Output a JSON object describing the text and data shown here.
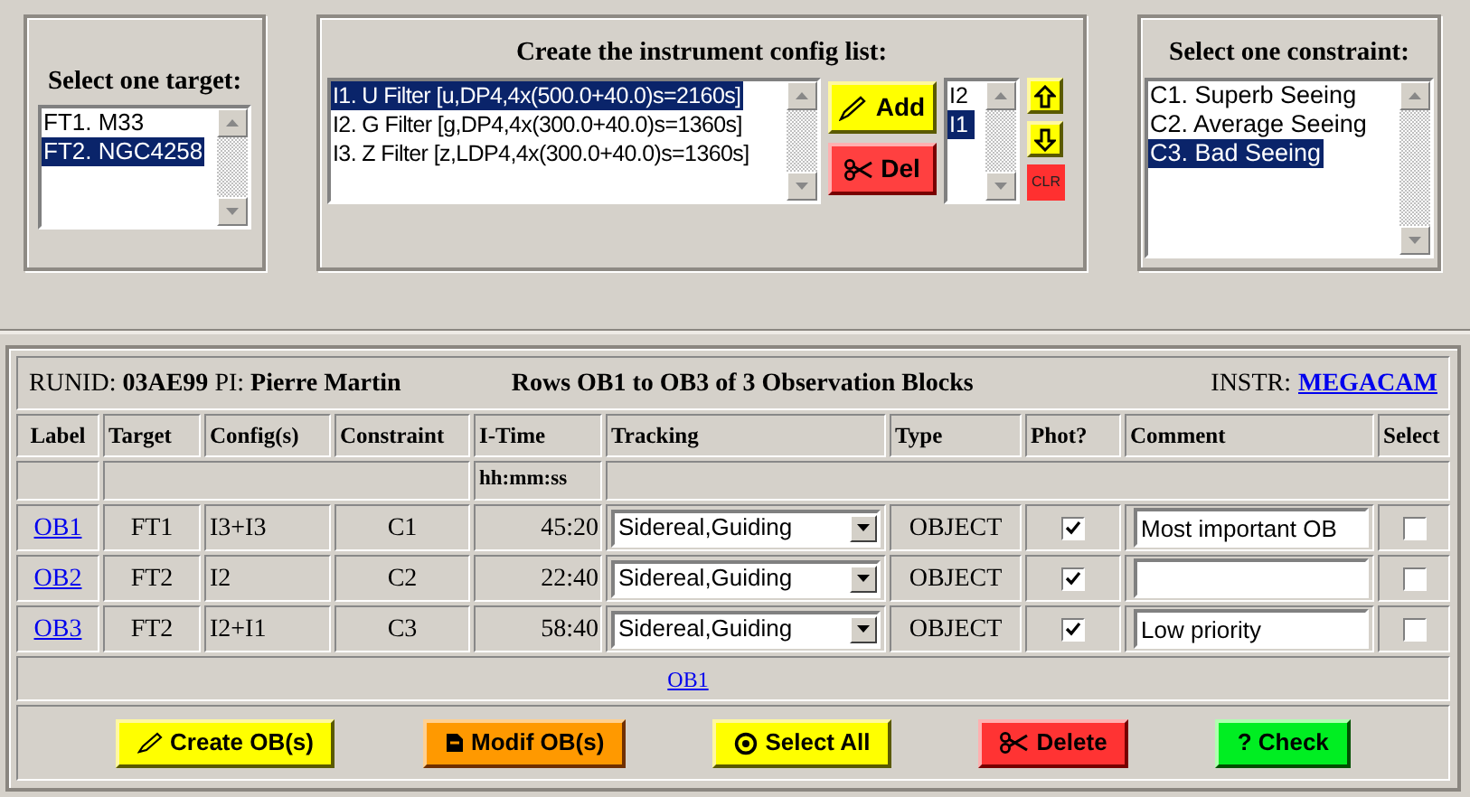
{
  "targets": {
    "title": "Select one target:",
    "items": [
      {
        "label": "FT1. M33",
        "selected": false
      },
      {
        "label": "FT2. NGC4258",
        "selected": true
      }
    ]
  },
  "configs": {
    "title": "Create the instrument config list:",
    "items": [
      {
        "label": "I1. U Filter [u,DP4,4x(500.0+40.0)s=2160s]",
        "selected": true
      },
      {
        "label": "I2. G Filter [g,DP4,4x(300.0+40.0)s=1360s]",
        "selected": false
      },
      {
        "label": "I3. Z Filter [z,LDP4,4x(300.0+40.0)s=1360s]",
        "selected": false
      }
    ],
    "add_button": "Add",
    "del_button": "Del",
    "chosen": [
      {
        "label": "I2",
        "selected": false
      },
      {
        "label": "I1",
        "selected": true
      }
    ],
    "clear_button": "CLR"
  },
  "constraints": {
    "title": "Select one constraint:",
    "items": [
      {
        "label": "C1. Superb Seeing",
        "selected": false
      },
      {
        "label": "C2. Average Seeing",
        "selected": false
      },
      {
        "label": "C3. Bad Seeing",
        "selected": true
      }
    ]
  },
  "header": {
    "runid_label": "RUNID:",
    "runid": "03AE99",
    "pi_label": "PI:",
    "pi": "Pierre Martin",
    "rows_text": "Rows OB1 to OB3 of 3 Observation Blocks",
    "instr_label": "INSTR:",
    "instr": "MEGACAM"
  },
  "table": {
    "columns": [
      "Label",
      "Target",
      "Config(s)",
      "Constraint",
      "I-Time",
      "Tracking",
      "Type",
      "Phot?",
      "Comment",
      "Select"
    ],
    "itime_unit": "hh:mm:ss",
    "rows": [
      {
        "label": "OB1",
        "target": "FT1",
        "configs": "I3+I3",
        "constraint": "C1",
        "itime": "45:20",
        "tracking": "Sidereal,Guiding",
        "type": "OBJECT",
        "phot": true,
        "comment": "Most important OB",
        "selected": false
      },
      {
        "label": "OB2",
        "target": "FT2",
        "configs": "I2",
        "constraint": "C2",
        "itime": "22:40",
        "tracking": "Sidereal,Guiding",
        "type": "OBJECT",
        "phot": true,
        "selected": false
      },
      {
        "label": "OB3",
        "target": "FT2",
        "configs": "I2+I1",
        "constraint": "C3",
        "itime": "58:40",
        "tracking": "Sidereal,Guiding",
        "type": "OBJECT",
        "phot": true,
        "comment": "Low priority",
        "selected": false
      }
    ],
    "footer_link": "OB1"
  },
  "actions": [
    {
      "kind": "create",
      "label": "Create OB(s)"
    },
    {
      "kind": "modify",
      "label": "Modif OB(s)"
    },
    {
      "kind": "select_all",
      "label": "Select All"
    },
    {
      "kind": "delete",
      "label": "Delete"
    },
    {
      "kind": "check",
      "label": "? Check"
    }
  ]
}
